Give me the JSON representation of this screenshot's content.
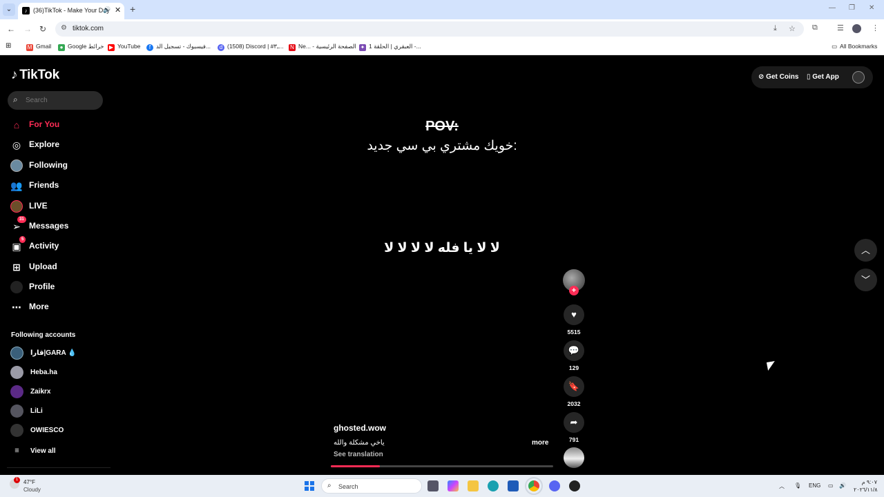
{
  "browser": {
    "tab_title": "(36)TikTok - Make Your Day",
    "url": "tiktok.com",
    "bookmarks": [
      {
        "label": "Gmail",
        "color": "#ea4335"
      },
      {
        "label": "Google خرائط",
        "color": "#34a853"
      },
      {
        "label": "YouTube",
        "color": "#ff0000"
      },
      {
        "label": "فيسبوك - تسجيل الد...",
        "color": "#1877f2"
      },
      {
        "label": "(1508) Discord | #ـ٣...",
        "color": "#5865f2"
      },
      {
        "label": "Ne... - الصفحة الرئيسية",
        "color": "#e50914"
      },
      {
        "label": "العبقري | الحلقة 1 -...",
        "color": "#7b4bb3"
      }
    ],
    "all_bookmarks": "All Bookmarks"
  },
  "sidebar": {
    "logo": "TikTok",
    "search_placeholder": "Search",
    "nav": [
      {
        "label": "For You",
        "icon": "home-icon"
      },
      {
        "label": "Explore",
        "icon": "compass-icon"
      },
      {
        "label": "Following",
        "icon": "avatar-icon"
      },
      {
        "label": "Friends",
        "icon": "friends-icon"
      },
      {
        "label": "LIVE",
        "icon": "live-avatar-icon"
      },
      {
        "label": "Messages",
        "icon": "send-icon",
        "badge": "31"
      },
      {
        "label": "Activity",
        "icon": "inbox-icon",
        "badge": "5"
      },
      {
        "label": "Upload",
        "icon": "plus-square-icon"
      },
      {
        "label": "Profile",
        "icon": "profile-avatar-icon"
      },
      {
        "label": "More",
        "icon": "more-icon"
      }
    ],
    "following_accounts_title": "Following accounts",
    "accounts": [
      {
        "name": "قارا|GARA 💧",
        "color": "#3a5f7a"
      },
      {
        "name": "Heba.ha",
        "color": "#9a9aa6"
      },
      {
        "name": "Zaikrx",
        "color": "#5b2a86"
      },
      {
        "name": "LiLi",
        "color": "#55555f"
      },
      {
        "name": "OWIESCO",
        "color": "#333"
      }
    ],
    "view_all": "View all"
  },
  "header": {
    "get_coins": "Get Coins",
    "get_app": "Get App"
  },
  "video": {
    "pov": "POV:",
    "line1": "خويك مشتري بي سي جديد:",
    "line2": "لا لا يا فله لا لا لا لا",
    "creator": "ghosted.wow",
    "caption": "ياخي مشكلة والله",
    "see_translation": "See translation",
    "more": "more",
    "progress": 0.22,
    "likes": "5515",
    "comments": "129",
    "saves": "2032",
    "shares": "791"
  },
  "taskbar": {
    "temperature": "47°F",
    "condition": "Cloudy",
    "weather_badge": "1",
    "search_label": "Search",
    "language": "ENG",
    "time": "٩:٠٧ م",
    "date": "٢٠٢٦/١١/٨"
  }
}
